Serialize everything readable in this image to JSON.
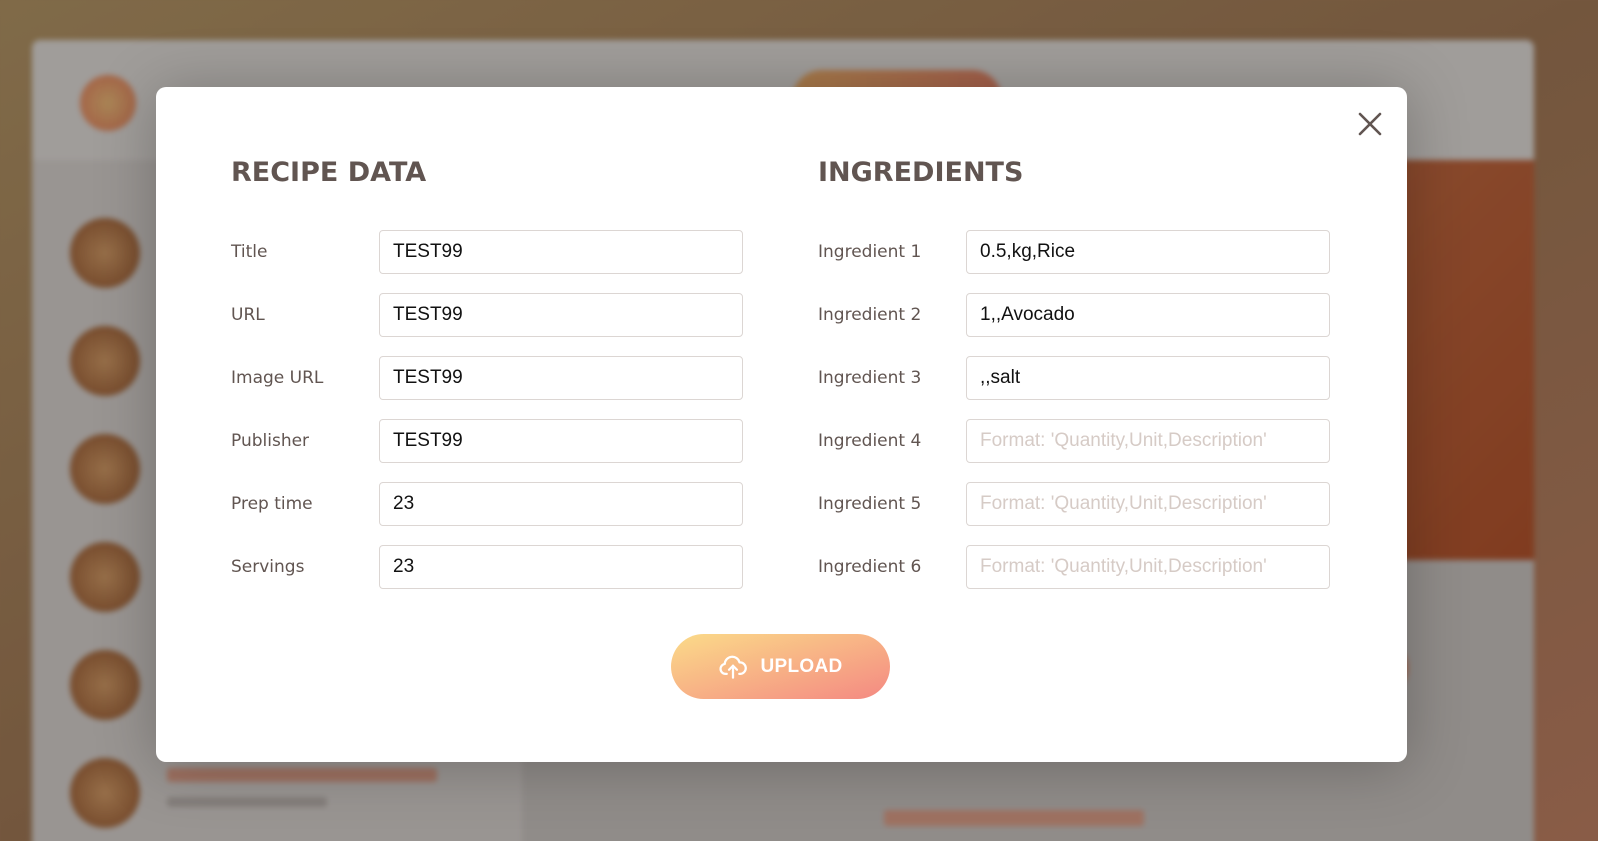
{
  "modal": {
    "close_label": "×",
    "recipe_heading": "RECIPE DATA",
    "ingredients_heading": "INGREDIENTS",
    "recipe_fields": [
      {
        "label": "Title",
        "value": "TEST99"
      },
      {
        "label": "URL",
        "value": "TEST99"
      },
      {
        "label": "Image URL",
        "value": "TEST99"
      },
      {
        "label": "Publisher",
        "value": "TEST99"
      },
      {
        "label": "Prep time",
        "value": "23"
      },
      {
        "label": "Servings",
        "value": "23"
      }
    ],
    "ingredient_fields": [
      {
        "label": "Ingredient 1",
        "value": "0.5,kg,Rice",
        "placeholder": "Format: 'Quantity,Unit,Description'"
      },
      {
        "label": "Ingredient 2",
        "value": "1,,Avocado",
        "placeholder": "Format: 'Quantity,Unit,Description'"
      },
      {
        "label": "Ingredient 3",
        "value": ",,salt",
        "placeholder": "Format: 'Quantity,Unit,Description'"
      },
      {
        "label": "Ingredient 4",
        "value": "",
        "placeholder": "Format: 'Quantity,Unit,Description'"
      },
      {
        "label": "Ingredient 5",
        "value": "",
        "placeholder": "Format: 'Quantity,Unit,Description'"
      },
      {
        "label": "Ingredient 6",
        "value": "",
        "placeholder": "Format: 'Quantity,Unit,Description'"
      }
    ],
    "upload_label": "UPLOAD",
    "upload_icon": "upload-cloud-icon"
  },
  "colors": {
    "heading": "#615551",
    "accent_start": "#fbdb89",
    "accent_end": "#f48982"
  }
}
